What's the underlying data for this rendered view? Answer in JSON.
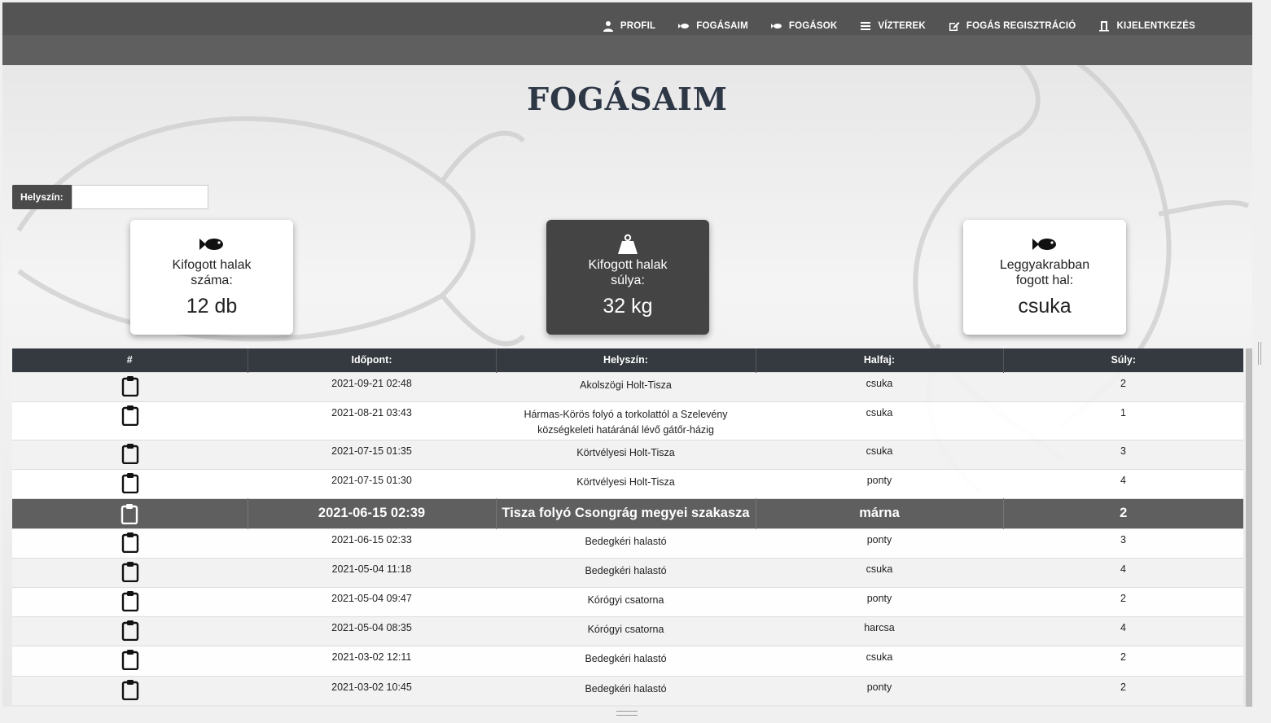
{
  "nav": {
    "items": [
      {
        "label": "PROFIL",
        "icon": "user-icon"
      },
      {
        "label": "FOGÁSAIM",
        "icon": "fish-icon"
      },
      {
        "label": "FOGÁSOK",
        "icon": "fish-icon"
      },
      {
        "label": "VÍZTEREK",
        "icon": "list-icon"
      },
      {
        "label": "FOGÁS REGISZTRÁCIÓ",
        "icon": "edit-icon"
      },
      {
        "label": "KIJELENTKEZÉS",
        "icon": "door-icon"
      }
    ]
  },
  "page": {
    "title": "FOGÁSAIM"
  },
  "filter": {
    "label": "Helyszín:",
    "value": ""
  },
  "stats": [
    {
      "icon": "fish-icon",
      "label": "Kifogott halak száma:",
      "value": "12 db",
      "style": "light"
    },
    {
      "icon": "weight-icon",
      "label": "Kifogott halak súlya:",
      "value": "32 kg",
      "style": "dark"
    },
    {
      "icon": "fish-icon",
      "label": "Leggyakrabban fogott hal:",
      "value": "csuka",
      "style": "light"
    }
  ],
  "table": {
    "headers": [
      "#",
      "Időpont:",
      "Helyszín:",
      "Halfaj:",
      "Súly:"
    ],
    "rows": [
      {
        "time": "2021-09-21 02:48",
        "place": "Akolszögi Holt-Tisza",
        "species": "csuka",
        "weight": "2"
      },
      {
        "time": "2021-08-21 03:43",
        "place": "Hármas-Körös folyó a torkolattól a Szelevény községkeleti határánál lévő gátőr-házig",
        "species": "csuka",
        "weight": "1"
      },
      {
        "time": "2021-07-15 01:35",
        "place": "Körtvélyesi Holt-Tisza",
        "species": "csuka",
        "weight": "3"
      },
      {
        "time": "2021-07-15 01:30",
        "place": "Körtvélyesi Holt-Tisza",
        "species": "ponty",
        "weight": "4"
      },
      {
        "time": "2021-06-15 02:39",
        "place": "Tisza folyó Csongrág megyei szakasza",
        "species": "márna",
        "weight": "2",
        "highlight": true
      },
      {
        "time": "2021-06-15 02:33",
        "place": "Bedegkéri halastó",
        "species": "ponty",
        "weight": "3"
      },
      {
        "time": "2021-05-04 11:18",
        "place": "Bedegkéri halastó",
        "species": "csuka",
        "weight": "4"
      },
      {
        "time": "2021-05-04 09:47",
        "place": "Kórógyi csatorna",
        "species": "ponty",
        "weight": "2"
      },
      {
        "time": "2021-05-04 08:35",
        "place": "Kórógyi csatorna",
        "species": "harcsa",
        "weight": "4"
      },
      {
        "time": "2021-03-02 12:11",
        "place": "Bedegkéri halastó",
        "species": "csuka",
        "weight": "2"
      },
      {
        "time": "2021-03-02 10:45",
        "place": "Bedegkéri halastó",
        "species": "ponty",
        "weight": "2"
      }
    ]
  }
}
